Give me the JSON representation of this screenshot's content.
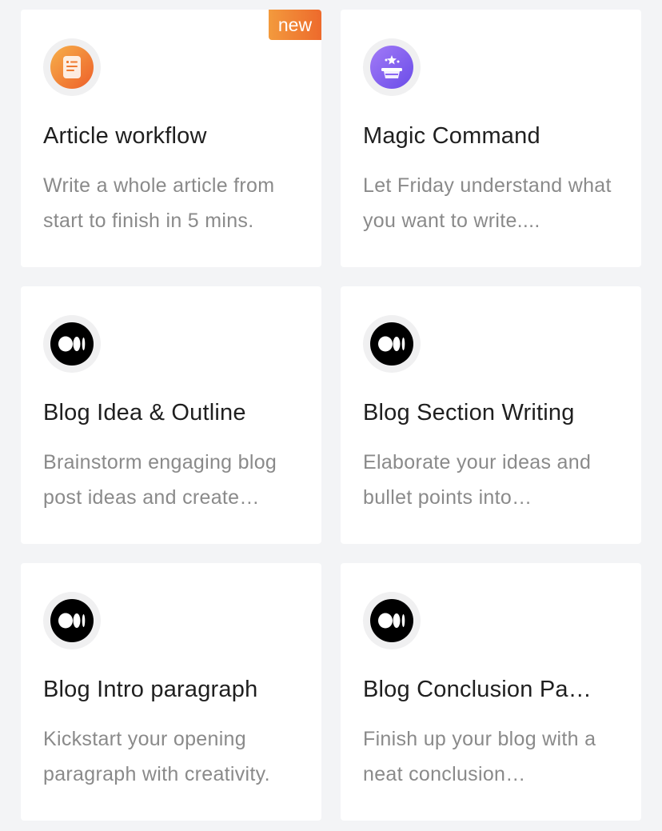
{
  "cards": [
    {
      "title": "Article workflow",
      "description": "Write a whole article from start to finish in 5 mins.",
      "badge": "new",
      "icon": "article-list-icon",
      "icon_color": "#f07a2e"
    },
    {
      "title": "Magic Command",
      "description": "Let Friday understand what you want to write....",
      "icon": "magic-hat-icon",
      "icon_color": "#7b5cf0"
    },
    {
      "title": "Blog Idea & Outline",
      "description": "Brainstorm engaging blog post ideas and create…",
      "icon": "medium-logo-icon",
      "icon_color": "#000000"
    },
    {
      "title": "Blog Section Writing",
      "description": "Elaborate your ideas and bullet points into…",
      "icon": "medium-logo-icon",
      "icon_color": "#000000"
    },
    {
      "title": "Blog Intro paragraph",
      "description": "Kickstart your opening paragraph with creativity.",
      "icon": "medium-logo-icon",
      "icon_color": "#000000"
    },
    {
      "title": "Blog Conclusion Pa…",
      "description": "Finish up your blog with a neat conclusion…",
      "icon": "medium-logo-icon",
      "icon_color": "#000000"
    }
  ]
}
